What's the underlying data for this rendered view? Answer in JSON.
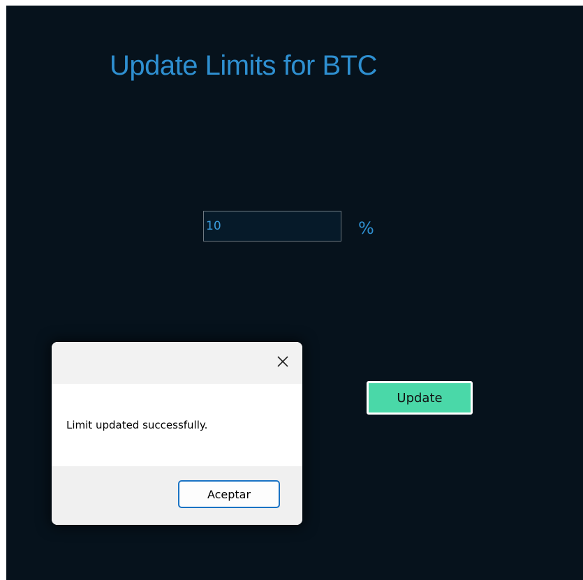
{
  "main": {
    "title": "Update Limits for BTC",
    "limit_value": "10",
    "unit": "%",
    "update_label": "Update"
  },
  "dialog": {
    "message": "Limit updated successfully.",
    "ok_label": "Aceptar",
    "close_icon": "close-icon"
  },
  "colors": {
    "background": "#06121c",
    "accent": "#2e8fd0",
    "update_button": "#4ad8a8",
    "dialog_button_border": "#1a73c4"
  }
}
